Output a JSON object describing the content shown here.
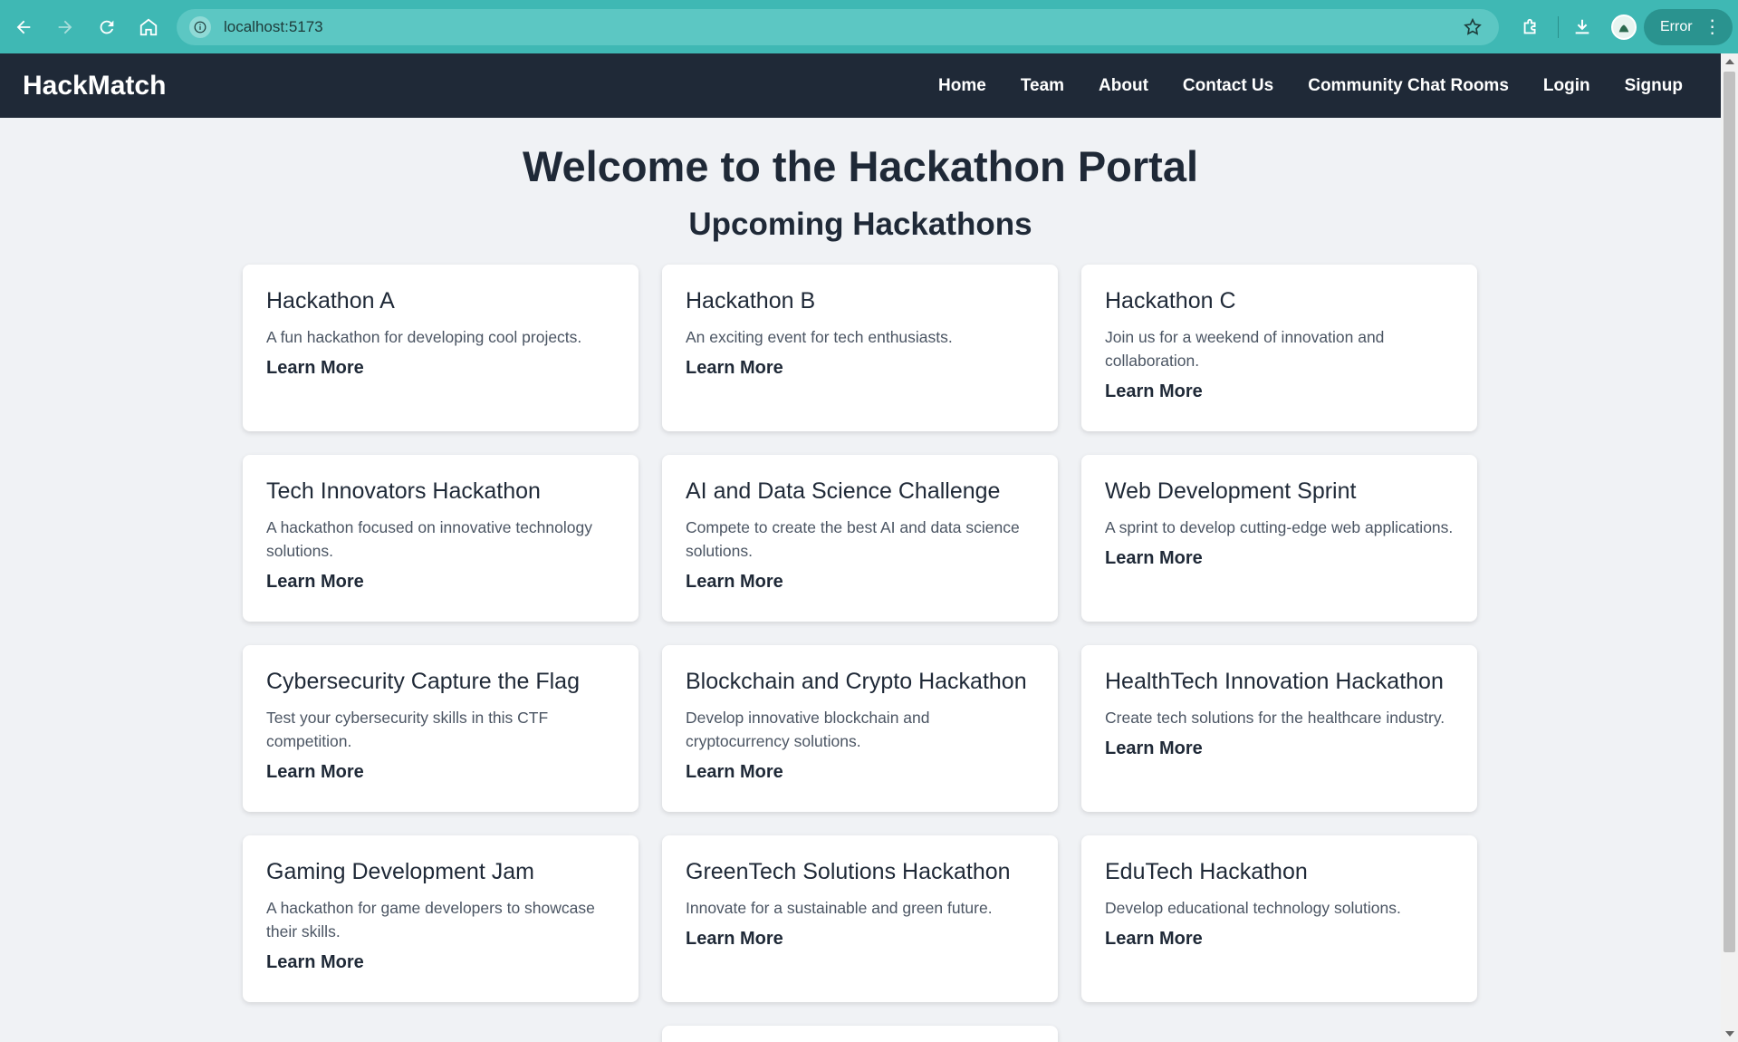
{
  "browser": {
    "url": "localhost:5173",
    "error_label": "Error"
  },
  "header": {
    "brand": "HackMatch",
    "nav": [
      "Home",
      "Team",
      "About",
      "Contact Us",
      "Community Chat Rooms",
      "Login",
      "Signup"
    ]
  },
  "main": {
    "title": "Welcome to the Hackathon Portal",
    "section_title": "Upcoming Hackathons",
    "learn_more_label": "Learn More",
    "hackathons": [
      {
        "name": "Hackathon A",
        "description": "A fun hackathon for developing cool projects."
      },
      {
        "name": "Hackathon B",
        "description": "An exciting event for tech enthusiasts."
      },
      {
        "name": "Hackathon C",
        "description": "Join us for a weekend of innovation and collaboration."
      },
      {
        "name": "Tech Innovators Hackathon",
        "description": "A hackathon focused on innovative technology solutions."
      },
      {
        "name": "AI and Data Science Challenge",
        "description": "Compete to create the best AI and data science solutions."
      },
      {
        "name": "Web Development Sprint",
        "description": "A sprint to develop cutting-edge web applications."
      },
      {
        "name": "Cybersecurity Capture the Flag",
        "description": "Test your cybersecurity skills in this CTF competition."
      },
      {
        "name": "Blockchain and Crypto Hackathon",
        "description": "Develop innovative blockchain and cryptocurrency solutions."
      },
      {
        "name": "HealthTech Innovation Hackathon",
        "description": "Create tech solutions for the healthcare industry."
      },
      {
        "name": "Gaming Development Jam",
        "description": "A hackathon for game developers to showcase their skills."
      },
      {
        "name": "GreenTech Solutions Hackathon",
        "description": "Innovate for a sustainable and green future."
      },
      {
        "name": "EduTech Hackathon",
        "description": "Develop educational technology solutions."
      }
    ]
  },
  "colors": {
    "browser_bar": "#3fb8b4",
    "header_bg": "#1f2937",
    "page_bg": "#f0f2f5",
    "card_bg": "#ffffff"
  }
}
